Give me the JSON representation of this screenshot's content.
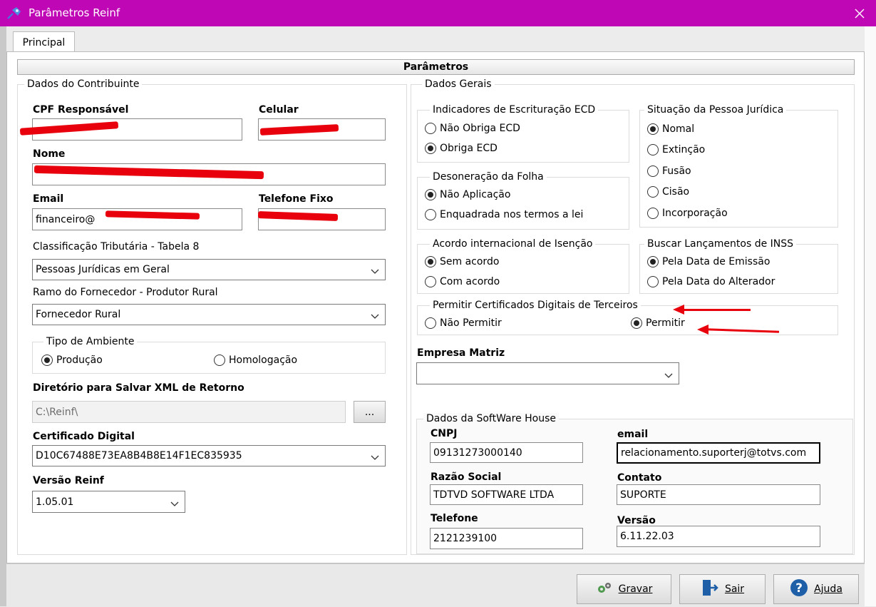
{
  "window": {
    "title": "Parâmetros Reinf",
    "close_icon": "close-icon"
  },
  "tabs": [
    {
      "label": "Principal",
      "active": true
    }
  ],
  "section_header": "Parâmetros",
  "contribuinte": {
    "group_label": "Dados do Contribuinte",
    "cpf": {
      "label": "CPF Responsável",
      "value": ""
    },
    "celular": {
      "label": "Celular",
      "value": ""
    },
    "nome": {
      "label": "Nome",
      "value": ""
    },
    "email": {
      "label": "Email",
      "value": "financeiro@"
    },
    "telefone_fixo": {
      "label": "Telefone Fixo",
      "value": ""
    },
    "classificacao": {
      "label": "Classificação Tributária - Tabela 8",
      "value": "Pessoas Jurídicas em Geral"
    },
    "ramo": {
      "label": "Ramo do Fornecedor - Produtor Rural",
      "value": "Fornecedor Rural"
    },
    "ambiente": {
      "group_label": "Tipo de Ambiente",
      "options": [
        "Produção",
        "Homologação"
      ],
      "selected": "Produção"
    },
    "diretorio": {
      "label": "Diretório para Salvar XML de Retorno",
      "value": "C:\\Reinf\\",
      "browse_label": "..."
    },
    "certificado": {
      "label": "Certificado Digital",
      "value": "D10C67488E73EA8B4B8E14F1EC835935"
    },
    "versao": {
      "label": "Versão Reinf",
      "value": "1.05.01"
    }
  },
  "gerais": {
    "group_label": "Dados Gerais",
    "ecd": {
      "label": "Indicadores de Escrituração ECD",
      "options": [
        "Não Obriga ECD",
        "Obriga ECD"
      ],
      "selected": "Obriga ECD"
    },
    "situacao": {
      "label": "Situação da Pessoa Jurídica",
      "options": [
        "Nomal",
        "Extinção",
        "Fusão",
        "Cisão",
        "Incorporação"
      ],
      "selected": "Nomal"
    },
    "desoneracao": {
      "label": "Desoneração da Folha",
      "options": [
        "Não Aplicação",
        "Enquadrada nos termos a lei"
      ],
      "selected": "Não Aplicação"
    },
    "acordo": {
      "label": "Acordo internacional de Isenção",
      "options": [
        "Sem acordo",
        "Com acordo"
      ],
      "selected": "Sem acordo"
    },
    "inss": {
      "label": "Buscar Lançamentos de INSS",
      "options": [
        "Pela Data de Emissão",
        "Pela Data do Alterador"
      ],
      "selected": "Pela Data de Emissão"
    },
    "certificados": {
      "label": "Permitir Certificados Digitais de Terceiros",
      "options": [
        "Não Permitir",
        "Permitir"
      ],
      "selected": "Permitir"
    },
    "empresa_matriz": {
      "label": "Empresa Matriz",
      "value": ""
    }
  },
  "software_house": {
    "group_label": "Dados da SoftWare House",
    "cnpj": {
      "label": "CNPJ",
      "value": "09131273000140"
    },
    "email": {
      "label": "email",
      "value": "relacionamento.suporterj@totvs.com"
    },
    "razao_social": {
      "label": "Razão Social",
      "value": "TDTVD SOFTWARE LTDA"
    },
    "contato": {
      "label": "Contato",
      "value": "SUPORTE"
    },
    "telefone": {
      "label": "Telefone",
      "value": "2121239100"
    },
    "versao": {
      "label": "Versão",
      "value": "6.11.22.03"
    }
  },
  "footer": {
    "gravar": {
      "label": "Gravar",
      "icon": "gears-icon"
    },
    "sair": {
      "label": "Sair",
      "icon": "exit-door-icon"
    },
    "ajuda": {
      "label": "Ajuda",
      "icon": "help-icon"
    }
  },
  "colors": {
    "titlebar": "#c007b5",
    "annotation_red": "#e8000c"
  }
}
